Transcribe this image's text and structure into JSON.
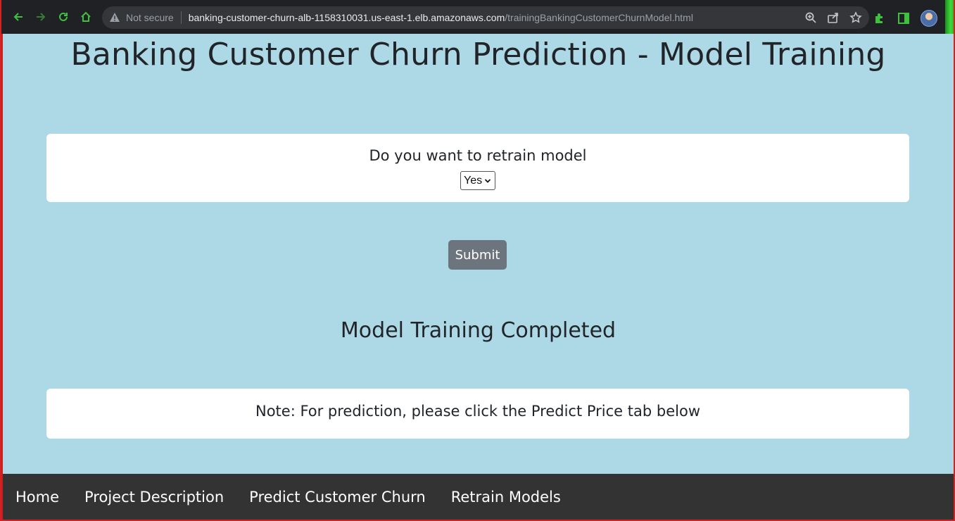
{
  "browser": {
    "security_label": "Not secure",
    "url_host": "banking-customer-churn-alb-1158310031.us-east-1.elb.amazonaws.com",
    "url_path": "/trainingBankingCustomerChurnModel.html",
    "accent_color": "#3ec23e"
  },
  "page": {
    "title": "Banking Customer Churn Prediction - Model Training",
    "retrain_question": "Do you want to retrain model",
    "retrain_select_value": "Yes",
    "submit_label": "Submit",
    "status_heading": "Model Training Completed",
    "note": "Note: For prediction, please click the Predict Price tab below",
    "background_color": "#add8e6"
  },
  "nav": {
    "items": [
      {
        "label": "Home"
      },
      {
        "label": "Project Description"
      },
      {
        "label": "Predict Customer Churn"
      },
      {
        "label": "Retrain Models"
      }
    ]
  }
}
